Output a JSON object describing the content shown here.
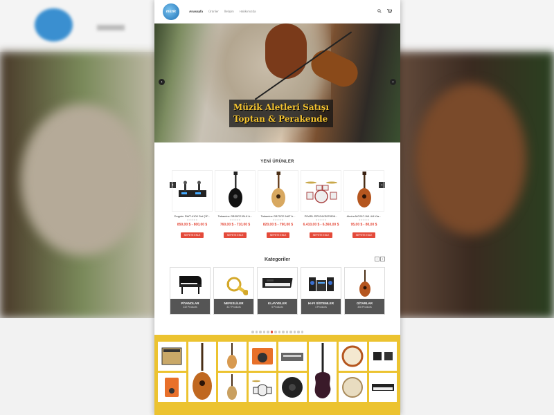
{
  "header": {
    "logo_text": "müzik",
    "nav": [
      "Anasayfa",
      "Ürünler",
      "İletişim",
      "Hakkımızda"
    ],
    "search_icon": "search-icon",
    "cart_icon": "cart-icon"
  },
  "hero": {
    "line1": "Müzik Aletleri Satışı",
    "line2": "Toptan & Perakende",
    "prev": "‹",
    "next": "›"
  },
  "new_products": {
    "title": "YENİ ÜRÜNLER",
    "items": [
      {
        "name": "Doppler DWT-4100 Set ÇİF...",
        "price": "850,00 $ - 800,00 $",
        "button": "SEPETE EKLE",
        "icon": "wireless-mic-set"
      },
      {
        "name": "Takamine GB30CE-BLK A...",
        "price": "760,00 $ - 710,00 $",
        "button": "SEPETE EKLE",
        "icon": "black-acoustic-guitar"
      },
      {
        "name": "Takamine GB72CE-NAT A...",
        "price": "820,00 $ - 790,00 $",
        "button": "SEPETE EKLE",
        "icon": "natural-acoustic-guitar"
      },
      {
        "name": "PEARL RP924XE0P/806...",
        "price": "6.410,00 $ - 6.360,00 $",
        "button": "SEPETE EKLE",
        "icon": "drum-kit"
      },
      {
        "name": "Almira MG917-W4 4/4 Kla...",
        "price": "95,00 $ - 80,00 $",
        "button": "SEPETE EKLE",
        "icon": "classical-guitar"
      }
    ],
    "stars": "★★★★★"
  },
  "categories": {
    "title": "Kategoriler",
    "items": [
      {
        "name": "PİYANOLAR",
        "count": "232 Products",
        "icon": "piano"
      },
      {
        "name": "NEFESLİLER",
        "count": "327 Products",
        "icon": "horn"
      },
      {
        "name": "KLAVYELER",
        "count": "5 Products",
        "icon": "keyboard"
      },
      {
        "name": "HI-FI SİSTEMLER",
        "count": "4 Products",
        "icon": "hifi"
      },
      {
        "name": "GİTARLAR",
        "count": "308 Products",
        "icon": "guitar"
      }
    ],
    "dots": 14,
    "active_dot": 5
  },
  "colors": {
    "accent": "#e44a3a",
    "mosaic_bg": "#ecc330"
  }
}
